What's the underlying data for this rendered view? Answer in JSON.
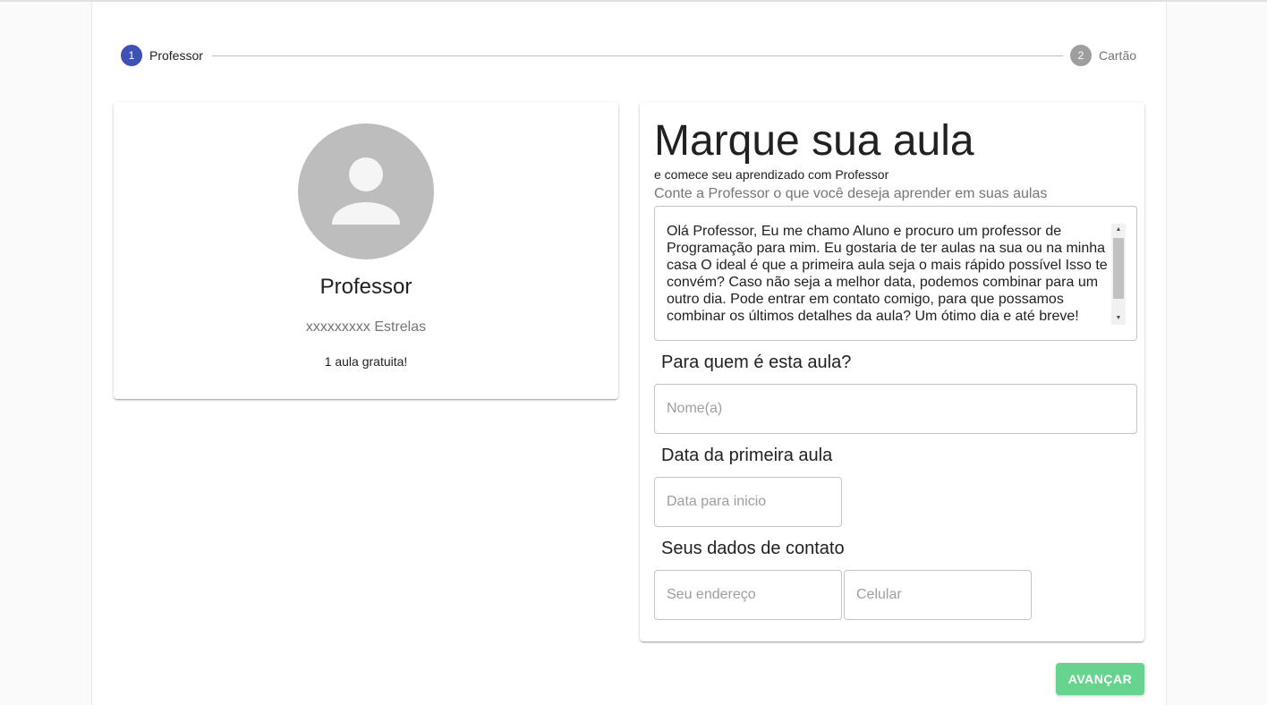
{
  "stepper": {
    "steps": [
      {
        "number": "1",
        "label": "Professor"
      },
      {
        "number": "2",
        "label": "Cartão"
      }
    ]
  },
  "teacher": {
    "name": "Professor",
    "rating": "xxxxxxxxx Estrelas",
    "free_lessons": "1 aula gratuita!"
  },
  "form": {
    "title": "Marque sua aula",
    "subtitle": "e comece seu aprendizado com Professor",
    "message_hint": "Conte a Professor o que você deseja aprender em suas aulas",
    "message_value": "Olá Professor, Eu me chamo Aluno e procuro um professor de Programação para mim. Eu gostaria de ter aulas na sua ou na minha casa O ideal é que a primeira aula seja o mais rápido possível Isso te convém? Caso não seja a melhor data, podemos combinar para um outro dia. Pode entrar em contato comigo, para que possamos combinar os últimos detalhes da aula? Um ótimo dia e até breve!",
    "who_label": "Para quem é esta aula?",
    "name_placeholder": "Nome(a)",
    "date_label": "Data da primeira aula",
    "date_placeholder": "Data para inicio",
    "contact_label": "Seus dados de contato",
    "address_placeholder": "Seu endereço",
    "phone_placeholder": "Celular"
  },
  "actions": {
    "next_label": "AVANÇAR"
  },
  "colors": {
    "step_active": "#3f51b5",
    "step_inactive": "#9e9e9e",
    "button": "#66d38e"
  }
}
